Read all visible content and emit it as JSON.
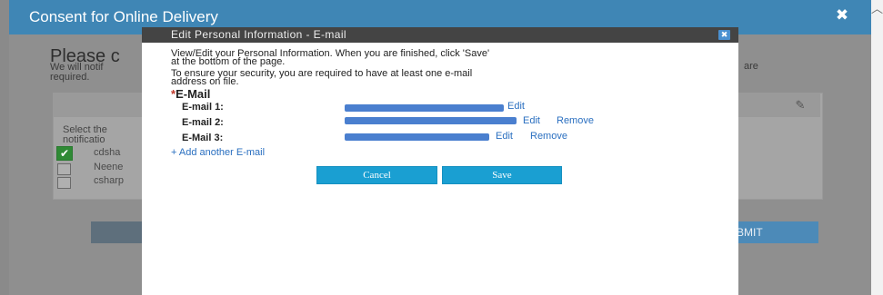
{
  "outer_dialog": {
    "title": "Consent for Online Delivery",
    "close_glyph": "✖",
    "heading": "Please c",
    "subtext_line1": "We will notif",
    "subtext_line2": "required.",
    "subtext_right": "are",
    "panel": {
      "select_line1": "Select the",
      "select_line2": "notificatio",
      "options": [
        {
          "label": "cdsha",
          "checked": true
        },
        {
          "label": "Neene",
          "checked": false
        },
        {
          "label": "csharp",
          "checked": false
        }
      ],
      "edit_icon": "pencil-icon"
    },
    "submit_label": "BMIT"
  },
  "dialog": {
    "title": "Edit Personal Information - E-mail",
    "close_icon": "close-icon",
    "close_glyph": "✖",
    "instructions_line1": "View/Edit your Personal Information. When you are finished, click 'Save'",
    "instructions_line2": "at the bottom of the page.",
    "security_line1": "To ensure your security, you are required to have at least one e-mail",
    "security_line2": "address on file.",
    "section_star": "*",
    "section_label": "E-Mail",
    "emails": [
      {
        "label": "E-mail 1:",
        "edit": "Edit"
      },
      {
        "label": "E-mail 2:",
        "edit": "Edit",
        "remove": "Remove"
      },
      {
        "label": "E-Mail 3:",
        "edit": "Edit",
        "remove": "Remove"
      }
    ],
    "add_link": "+ Add another E-mail",
    "cancel_label": "Cancel",
    "save_label": "Save"
  },
  "colors": {
    "outer_header": "#3f86b5",
    "dialog_header": "#444444",
    "button": "#1a9fd2",
    "link": "#2a6fc0",
    "redaction": "#4a7fcf"
  }
}
